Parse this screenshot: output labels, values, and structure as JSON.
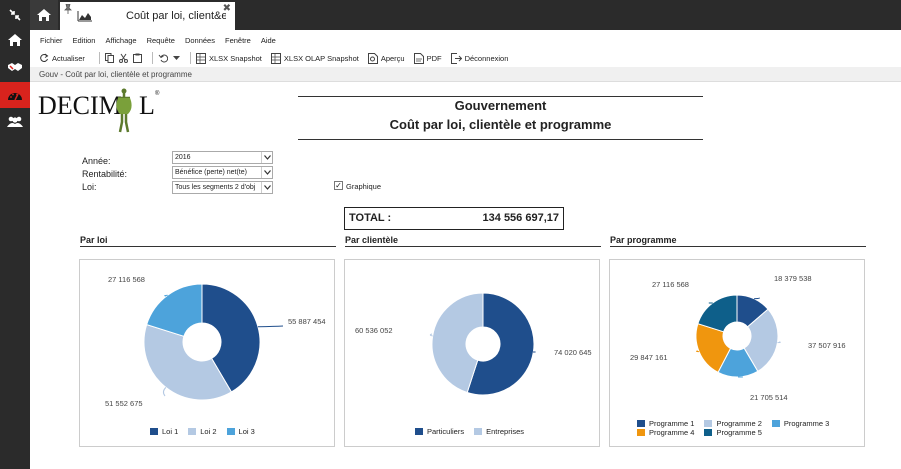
{
  "tab": {
    "title": "Coût par loi, client&eg..."
  },
  "menu": [
    "Fichier",
    "Edition",
    "Affichage",
    "Requête",
    "Données",
    "Fenêtre",
    "Aide"
  ],
  "toolbar": {
    "refresh": "Actualiser",
    "xlsx": "XLSX Snapshot",
    "olap": "XLSX OLAP Snapshot",
    "preview": "Aperçu",
    "pdf": "PDF",
    "logout": "Déconnexion"
  },
  "breadcrumb": "Gouv - Coût par loi, clientèle et programme",
  "logo": {
    "text": "DECIM L",
    "reg": "®"
  },
  "report": {
    "title1": "Gouvernement",
    "title2": "Coût par loi, clientèle et programme"
  },
  "filters": {
    "annee_label": "Année:",
    "annee_value": "2016",
    "rent_label": "Rentabilité:",
    "rent_value": "Bénéfice (perte) net(te)",
    "loi_label": "Loi:",
    "loi_value": "Tous les segments 2 d'obj"
  },
  "graphique": {
    "label": "Graphique",
    "checked": "✓"
  },
  "total": {
    "label": "TOTAL :",
    "value": "134 556 697,17"
  },
  "sections": {
    "loi": "Par loi",
    "clientele": "Par clientèle",
    "programme": "Par programme"
  },
  "colors": {
    "dark_blue": "#1f4e8c",
    "light_blue": "#b4c9e3",
    "mid_blue": "#4da3db",
    "orange": "#f0960e",
    "teal": "#0e5f8a",
    "rail": "#2b2b2b",
    "accent": "#d9231d"
  },
  "chart_data": [
    {
      "type": "pie",
      "categories": [
        "Loi 1",
        "Loi 2",
        "Loi 3"
      ],
      "values": [
        55887454,
        51552675,
        27116568
      ],
      "value_labels": [
        "55 887 454",
        "51 552 675",
        "27 116 568"
      ],
      "colors": [
        "#1f4e8c",
        "#b4c9e3",
        "#4da3db"
      ],
      "legend": "bottom"
    },
    {
      "type": "pie",
      "categories": [
        "Particuliers",
        "Entreprises"
      ],
      "values": [
        74020645,
        60536052
      ],
      "value_labels": [
        "74 020 645",
        "60 536 052"
      ],
      "colors": [
        "#1f4e8c",
        "#b4c9e3"
      ],
      "legend": "bottom"
    },
    {
      "type": "pie",
      "categories": [
        "Programme 1",
        "Programme 2",
        "Programme 3",
        "Programme 4",
        "Programme 5"
      ],
      "values": [
        18379538,
        37507916,
        21705514,
        29847161,
        27116568
      ],
      "value_labels": [
        "18 379 538",
        "37 507 916",
        "21 705 514",
        "29 847 161",
        "27 116 568"
      ],
      "colors": [
        "#1f4e8c",
        "#b4c9e3",
        "#4da3db",
        "#f0960e",
        "#0e5f8a"
      ],
      "legend": "bottom"
    }
  ]
}
